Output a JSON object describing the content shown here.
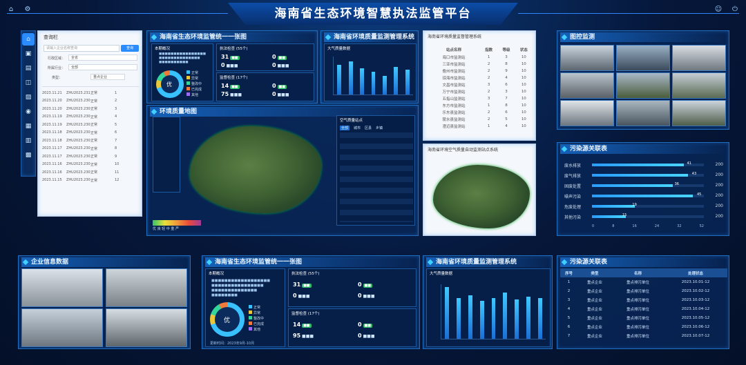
{
  "header": {
    "title": "海南省生态环境智慧执法监管平台"
  },
  "left_panel": {
    "title": "查询栏",
    "search_placeholder": "请输入企业名称查询",
    "search_button": "查询",
    "filter1_label": "行政区域：",
    "filter1_value": "全省",
    "filter2_label": "所属行业：",
    "filter2_value": "全部",
    "filter3_label": "类型：",
    "filter3_value": "重点企业",
    "rows": [
      [
        "2023.11.21",
        "ZHU2023.23107",
        "正常",
        "1"
      ],
      [
        "2023.11.20",
        "ZHU2023.23098",
        "正常",
        "2"
      ],
      [
        "2023.11.20",
        "ZHU2023.23087",
        "正常",
        "3"
      ],
      [
        "2023.11.19",
        "ZHU2023.23075",
        "正常",
        "4"
      ],
      [
        "2023.11.19",
        "ZHU2023.23066",
        "正常",
        "5"
      ],
      [
        "2023.11.18",
        "ZHU2023.23054",
        "正常",
        "6"
      ],
      [
        "2023.11.18",
        "ZHU2023.23043",
        "正常",
        "7"
      ],
      [
        "2023.11.17",
        "ZHU2023.23032",
        "正常",
        "8"
      ],
      [
        "2023.11.17",
        "ZHU2023.23021",
        "正常",
        "9"
      ],
      [
        "2023.11.16",
        "ZHU2023.23010",
        "正常",
        "10"
      ],
      [
        "2023.11.16",
        "ZHU2023.23009",
        "正常",
        "11"
      ],
      [
        "2023.11.15",
        "ZHU2023.23008",
        "正常",
        "12"
      ]
    ]
  },
  "supervision_panel": {
    "title": "海南省生态环境监管统一一张图",
    "sub1": "本期概况",
    "sub2": "执法检查 (55个)",
    "sub3": "监督检查 (17个)",
    "legend": [
      "正常",
      "异常",
      "整改中",
      "已完成",
      "其他"
    ],
    "donut_center": "优"
  },
  "monitor_chart_panel": {
    "title": "海南省环境质量监测管理系统",
    "sub": "大气质量数据",
    "values": [
      62,
      70,
      55,
      48,
      40,
      58,
      52
    ]
  },
  "map_panel": {
    "title": "环境质量地图",
    "legend": "优 良 轻 中 重 严"
  },
  "map_table": {
    "title": "空气质量站点",
    "tabs": [
      "全部",
      "城市",
      "区县",
      "乡镇"
    ]
  },
  "white_table_panel": {
    "title": "海南省环境质量监督管理系统",
    "headers": [
      "站点名称",
      "指数",
      "等级",
      "状态"
    ],
    "rows": [
      [
        "海口市监测站",
        "1",
        "3",
        "10"
      ],
      [
        "三亚市监测站",
        "2",
        "8",
        "10"
      ],
      [
        "儋州市监测站",
        "2",
        "9",
        "10"
      ],
      [
        "琼海市监测站",
        "2",
        "4",
        "10"
      ],
      [
        "文昌市监测站",
        "3",
        "6",
        "10"
      ],
      [
        "万宁市监测站",
        "2",
        "3",
        "10"
      ],
      [
        "五指山监测站",
        "3",
        "7",
        "10"
      ],
      [
        "东方市监测站",
        "1",
        "8",
        "10"
      ],
      [
        "乐东县监测站",
        "2",
        "6",
        "10"
      ],
      [
        "陵水县监测站",
        "2",
        "5",
        "10"
      ],
      [
        "澄迈县监测站",
        "1",
        "4",
        "10"
      ]
    ]
  },
  "white_map_panel": {
    "title": "海南省环境空气质量自动监测站点系统"
  },
  "camera_panel": {
    "title": "图控监测"
  },
  "pollution_panel": {
    "title": "污染源关联表",
    "items": [
      {
        "label": "废水排放",
        "value": "41"
      },
      {
        "label": "废气排放",
        "value": "43"
      },
      {
        "label": "固废处置",
        "value": "36"
      },
      {
        "label": "噪声污染",
        "value": "45"
      },
      {
        "label": "危废处理",
        "value": "19"
      },
      {
        "label": "其他污染",
        "value": "15"
      }
    ],
    "max_labels": [
      "200",
      "200",
      "200",
      "200",
      "200",
      "200"
    ],
    "axis": [
      "0",
      "8",
      "16",
      "24",
      "32",
      "52"
    ]
  },
  "enterprise_panel": {
    "title": "企业信息数据"
  },
  "supervision_panel2": {
    "title": "海南省生态环境监管统一一张图",
    "sub1": "本期概况",
    "sub2": "执法检查 (55个)",
    "sub3": "监督检查 (17个)",
    "donut_center": "优",
    "footer": "更新时间：2023年9月-10月"
  },
  "monitor_chart_panel2": {
    "title": "海南省环境质量监测管理系统",
    "sub": "大气质量数据",
    "values": [
      380,
      300,
      320,
      280,
      300,
      340,
      290,
      310,
      300
    ]
  },
  "pollution_table": {
    "title": "污染源关联表",
    "headers": [
      "序号",
      "类型",
      "名称",
      "处理状态"
    ],
    "rows": [
      [
        "1",
        "重点企业",
        "重点排污单位",
        "2023.10.01-12"
      ],
      [
        "2",
        "重点企业",
        "重点排污单位",
        "2023.10.02-12"
      ],
      [
        "3",
        "重点企业",
        "重点排污单位",
        "2023.10.03-12"
      ],
      [
        "4",
        "重点企业",
        "重点排污单位",
        "2023.10.04-12"
      ],
      [
        "5",
        "重点企业",
        "重点排污单位",
        "2023.10.05-12"
      ],
      [
        "6",
        "重点企业",
        "重点排污单位",
        "2023.10.06-12"
      ],
      [
        "7",
        "重点企业",
        "重点排污单位",
        "2023.10.07-12"
      ]
    ]
  }
}
